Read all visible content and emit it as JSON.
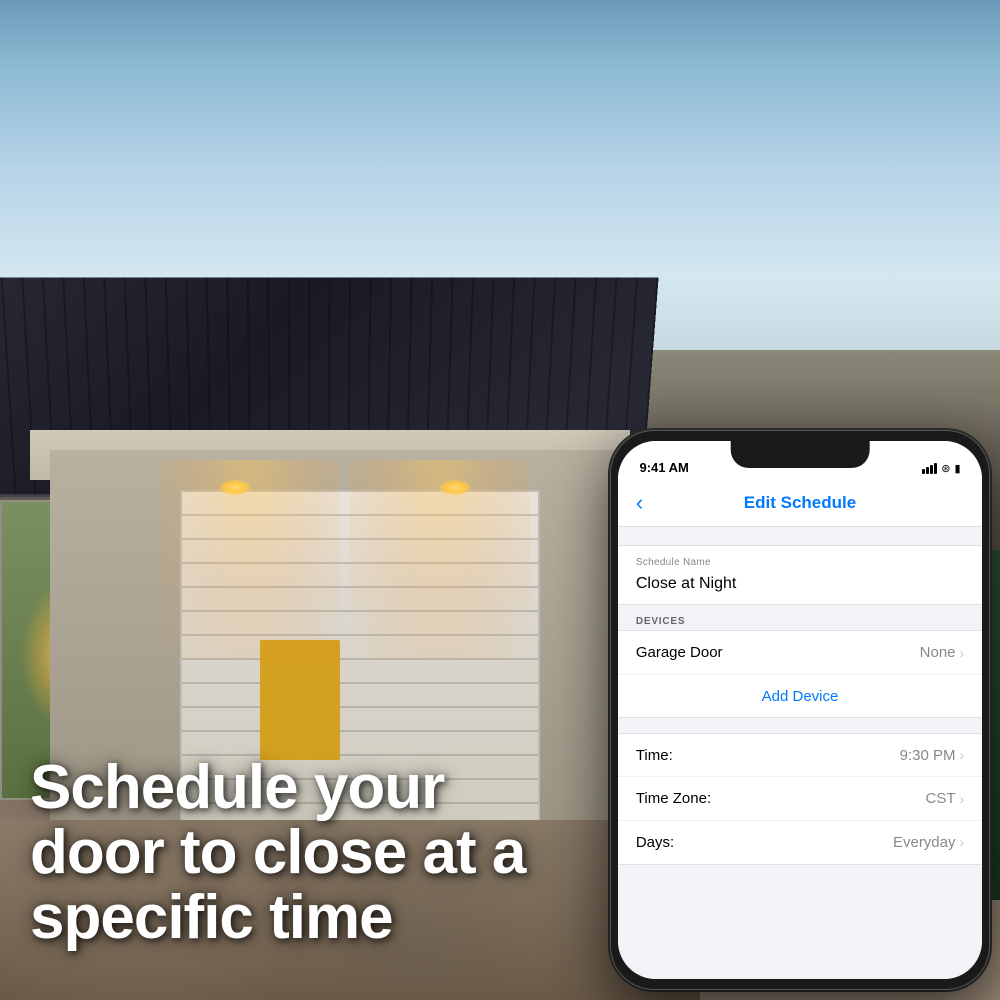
{
  "background": {
    "alt": "House with garage door at night"
  },
  "marketing": {
    "headline": "Schedule your door to close at a specific time"
  },
  "phone": {
    "status_bar": {
      "time": "9:41 AM"
    },
    "nav": {
      "back_label": "‹",
      "title": "Edit Schedule"
    },
    "schedule_name": {
      "label": "Schedule Name",
      "value": "Close at Night"
    },
    "devices_section": {
      "header": "DEVICES",
      "rows": [
        {
          "label": "Garage Door",
          "value": "None"
        }
      ],
      "add_button": "Add Device"
    },
    "time_rows": [
      {
        "label": "Time:",
        "value": "9:30 PM"
      },
      {
        "label": "Time Zone:",
        "value": "CST"
      },
      {
        "label": "Days:",
        "value": "Everyday"
      }
    ]
  }
}
